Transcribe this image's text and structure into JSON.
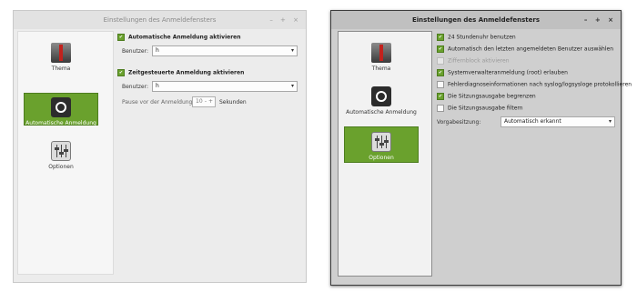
{
  "left_window": {
    "title": "Einstellungen des Anmeldefensters",
    "window_controls": "– + ×",
    "sidebar": [
      {
        "label": "Thema",
        "icon": "theme-icon"
      },
      {
        "label": "Automatische Anmeldung",
        "icon": "auto-login-icon",
        "active": true
      },
      {
        "label": "Optionen",
        "icon": "options-icon"
      }
    ],
    "auto_login": {
      "checkbox_label": "Automatische Anmeldung aktivieren",
      "checked": true,
      "user_label": "Benutzer:",
      "user_value": "h"
    },
    "timed_login": {
      "checkbox_label": "Zeitgesteuerte Anmeldung aktivieren",
      "checked": true,
      "user_label": "Benutzer:",
      "user_value": "h",
      "pause_label": "Pause vor der Anmeldung:",
      "pause_value": "10",
      "spin_buttons": "- +",
      "unit_label": "Sekunden"
    }
  },
  "right_window": {
    "title": "Einstellungen des Anmeldefensters",
    "window_controls": "– + ×",
    "sidebar": [
      {
        "label": "Thema",
        "icon": "theme-icon"
      },
      {
        "label": "Automatische Anmeldung",
        "icon": "auto-login-icon"
      },
      {
        "label": "Optionen",
        "icon": "options-icon",
        "active": true
      }
    ],
    "options": [
      {
        "label": "24 Stundenuhr benutzen",
        "state": "checked"
      },
      {
        "label": "Automatisch den letzten angemeldeten Benutzer auswählen",
        "state": "checked"
      },
      {
        "label": "Ziffernblock aktivieren",
        "state": "disabled"
      },
      {
        "label": "Systemverwalteranmeldung (root) erlauben",
        "state": "checked"
      },
      {
        "label": "Fehlerdiagnoseinformationen nach syslog/logsysloge protokollieren",
        "state": "unchecked"
      },
      {
        "label": "Die Sitzungsausgabe begrenzen",
        "state": "checked"
      },
      {
        "label": "Die Sitzungsausgabe filtern",
        "state": "unchecked"
      }
    ],
    "preset_label": "Vorgabesitzung:",
    "preset_value": "Automatisch erkannt"
  },
  "colors": {
    "accent_green": "#6aa12d",
    "left_bg": "#ececec",
    "right_bg": "#cfcfcf"
  }
}
